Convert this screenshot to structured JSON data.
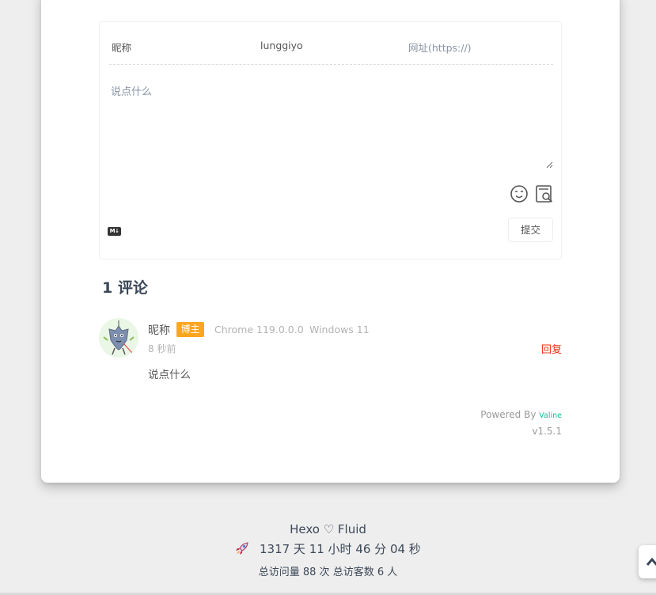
{
  "form": {
    "nick_label": "昵称",
    "mail_value": "lunggiyo",
    "link_placeholder": "网址(https://)",
    "textarea_placeholder": "说点什么",
    "markdown_badge": "M↓",
    "submit_label": "提交"
  },
  "comments": {
    "count_text": "1 评论",
    "items": [
      {
        "nick": "昵称",
        "badge": "博主",
        "browser": "Chrome 119.0.0.0",
        "os": "Windows 11",
        "time": "8 秒前",
        "reply_label": "回复",
        "content": "说点什么"
      }
    ]
  },
  "powered": {
    "prefix": "Powered By",
    "brand": "Valine",
    "version": "v1.5.1"
  },
  "footer": {
    "line1": "Hexo ♡ Fluid",
    "uptime_icon": "rocket-icon",
    "uptime": "1317 天 11 小时 46 分 04 秒",
    "stats": "总访问量 88 次 总访客数 6 人"
  },
  "colors": {
    "badge": "#ffa51e",
    "reply": "#ef2f11",
    "brand": "#1abc9c"
  }
}
